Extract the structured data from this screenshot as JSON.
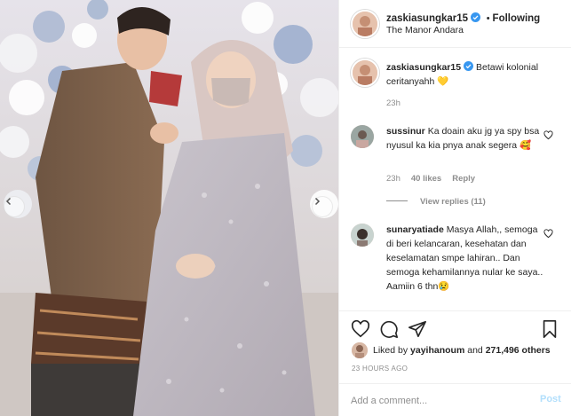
{
  "post": {
    "username": "zaskiasungkar15",
    "follow_separator": "•",
    "follow_label": "Following",
    "location": "The Manor Andara",
    "caption_text": "Betawi kolonial ceritanyahh",
    "caption_emoji": "💛",
    "caption_time": "23h"
  },
  "comments": [
    {
      "username": "sussinur",
      "text": "Ka doain aku jg ya spy bsa nyusul ka kia pnya anak segera 🥰",
      "time": "23h",
      "likes": "40 likes",
      "reply_label": "Reply",
      "view_replies": "View replies (11)"
    },
    {
      "username": "sunaryatiade",
      "text": "Masya Allah,, semoga di beri kelancaran, kesehatan dan keselamatan smpe lahiran.. Dan semoga kehamilannya nular ke saya.. Aamiin 6 thn😢"
    }
  ],
  "actions": {
    "liked_by_prefix": "Liked by",
    "liked_by_user": "yayihanoum",
    "liked_by_conj": "and",
    "liked_by_count": "271,496 others",
    "timestamp": "23 HOURS AGO"
  },
  "comment_box": {
    "placeholder": "Add a comment...",
    "post_label": "Post"
  },
  "icons": {
    "verified": "verified-badge-icon",
    "heart": "heart-icon",
    "comment": "comment-icon",
    "share": "share-icon",
    "save": "bookmark-icon",
    "prev": "chevron-left-icon",
    "next": "chevron-right-icon"
  },
  "colors": {
    "verified_blue": "#3897f0",
    "post_button": "#b2dffc",
    "muted_text": "#8e8e8e"
  }
}
